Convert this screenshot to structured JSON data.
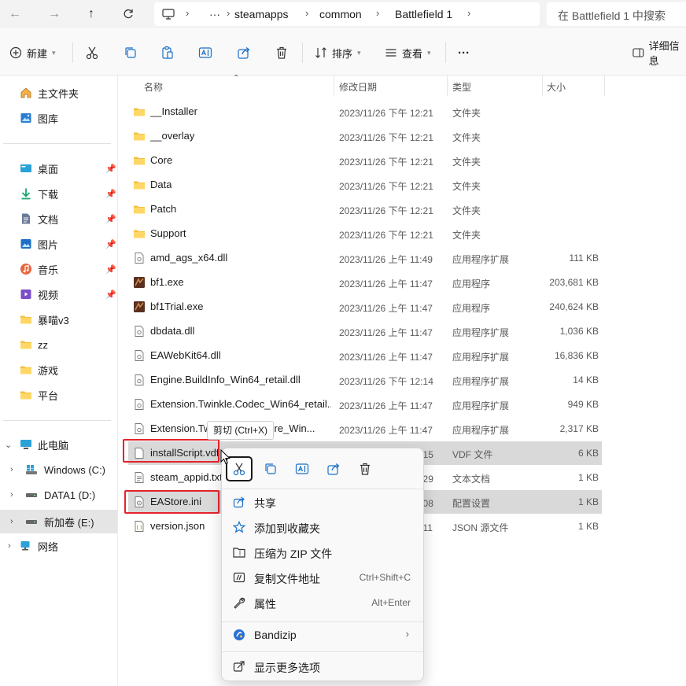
{
  "address_bar": {
    "breadcrumbs": [
      "steamapps",
      "common",
      "Battlefield 1"
    ],
    "search_placeholder": "在 Battlefield 1 中搜索"
  },
  "toolbar": {
    "new_label": "新建",
    "sort_label": "排序",
    "view_label": "查看",
    "more_label": "···",
    "details_label": "详细信息"
  },
  "sidebar": {
    "top_items": [
      {
        "label": "主文件夹",
        "icon": "home-icon"
      },
      {
        "label": "图库",
        "icon": "gallery-icon"
      }
    ],
    "quick_access": [
      {
        "label": "桌面",
        "icon": "desktop-icon"
      },
      {
        "label": "下载",
        "icon": "download-icon"
      },
      {
        "label": "文档",
        "icon": "document-icon"
      },
      {
        "label": "图片",
        "icon": "pictures-icon"
      },
      {
        "label": "音乐",
        "icon": "music-icon"
      },
      {
        "label": "视频",
        "icon": "video-icon"
      },
      {
        "label": "暴喵v3",
        "icon": "folder-icon"
      },
      {
        "label": "zz",
        "icon": "folder-icon"
      },
      {
        "label": "游戏",
        "icon": "folder-icon"
      },
      {
        "label": "平台",
        "icon": "folder-icon"
      }
    ],
    "this_pc": "此电脑",
    "drives": [
      "Windows (C:)",
      "DATA1 (D:)",
      "新加卷 (E:)"
    ],
    "network": "网络"
  },
  "columns": {
    "name": "名称",
    "date": "修改日期",
    "type": "类型",
    "size": "大小"
  },
  "files": [
    {
      "name": "__Installer",
      "date": "2023/11/26 下午 12:21",
      "type": "文件夹",
      "size": "",
      "icon": "folder-icon"
    },
    {
      "name": "__overlay",
      "date": "2023/11/26 下午 12:21",
      "type": "文件夹",
      "size": "",
      "icon": "folder-icon"
    },
    {
      "name": "Core",
      "date": "2023/11/26 下午 12:21",
      "type": "文件夹",
      "size": "",
      "icon": "folder-icon"
    },
    {
      "name": "Data",
      "date": "2023/11/26 下午 12:21",
      "type": "文件夹",
      "size": "",
      "icon": "folder-icon"
    },
    {
      "name": "Patch",
      "date": "2023/11/26 下午 12:21",
      "type": "文件夹",
      "size": "",
      "icon": "folder-icon"
    },
    {
      "name": "Support",
      "date": "2023/11/26 下午 12:21",
      "type": "文件夹",
      "size": "",
      "icon": "folder-icon"
    },
    {
      "name": "amd_ags_x64.dll",
      "date": "2023/11/26 上午 11:49",
      "type": "应用程序扩展",
      "size": "111 KB",
      "icon": "dll-file-icon"
    },
    {
      "name": "bf1.exe",
      "date": "2023/11/26 上午 11:47",
      "type": "应用程序",
      "size": "203,681 KB",
      "icon": "bf1-app-icon"
    },
    {
      "name": "bf1Trial.exe",
      "date": "2023/11/26 上午 11:47",
      "type": "应用程序",
      "size": "240,624 KB",
      "icon": "bf1-app-icon"
    },
    {
      "name": "dbdata.dll",
      "date": "2023/11/26 上午 11:47",
      "type": "应用程序扩展",
      "size": "1,036 KB",
      "icon": "dll-file-icon"
    },
    {
      "name": "EAWebKit64.dll",
      "date": "2023/11/26 上午 11:47",
      "type": "应用程序扩展",
      "size": "16,836 KB",
      "icon": "dll-file-icon"
    },
    {
      "name": "Engine.BuildInfo_Win64_retail.dll",
      "date": "2023/11/26 下午 12:14",
      "type": "应用程序扩展",
      "size": "14 KB",
      "icon": "dll-file-icon"
    },
    {
      "name": "Extension.Twinkle.Codec_Win64_retail...",
      "date": "2023/11/26 上午 11:47",
      "type": "应用程序扩展",
      "size": "949 KB",
      "icon": "dll-file-icon"
    },
    {
      "name": "Extension.Twinkle.ScriptCore_Win...",
      "date": "2023/11/26 上午 11:47",
      "type": "应用程序扩展",
      "size": "2,317 KB",
      "icon": "dll-file-icon"
    },
    {
      "name": "installScript.vdf",
      "date": "2023/11/26 下午 12:15",
      "type": "VDF 文件",
      "size": "6 KB",
      "icon": "blank-file-icon",
      "selected": true
    },
    {
      "name": "steam_appid.txt",
      "date": "2023/11/26 下午 12:29",
      "type": "文本文档",
      "size": "1 KB",
      "icon": "text-file-icon"
    },
    {
      "name": "EAStore.ini",
      "date": "2023/11/26 下午 12:08",
      "type": "配置设置",
      "size": "1 KB",
      "icon": "config-file-icon",
      "selected": true
    },
    {
      "name": "version.json",
      "date": "2023/11/26 下午 12:11",
      "type": "JSON 源文件",
      "size": "1 KB",
      "icon": "json-file-icon"
    }
  ],
  "tooltip": "剪切 (Ctrl+X)",
  "context_menu": {
    "quick_actions": [
      "cut-icon",
      "copy-icon",
      "rename-icon",
      "share-icon",
      "delete-icon"
    ],
    "items": [
      {
        "label": "共享",
        "shortcut": "",
        "icon": "share-icon"
      },
      {
        "label": "添加到收藏夹",
        "shortcut": "",
        "icon": "star-icon"
      },
      {
        "label": "压缩为 ZIP 文件",
        "shortcut": "",
        "icon": "zip-icon"
      },
      {
        "label": "复制文件地址",
        "shortcut": "Ctrl+Shift+C",
        "icon": "copy-path-icon"
      },
      {
        "label": "属性",
        "shortcut": "Alt+Enter",
        "icon": "wrench-icon"
      }
    ],
    "bandizip_label": "Bandizip",
    "more_options_label": "显示更多选项"
  },
  "colors": {
    "accent": "#0067c0",
    "folder": "#f3c242",
    "highlight": "#e3242b",
    "selection": "#d9d9d9"
  }
}
